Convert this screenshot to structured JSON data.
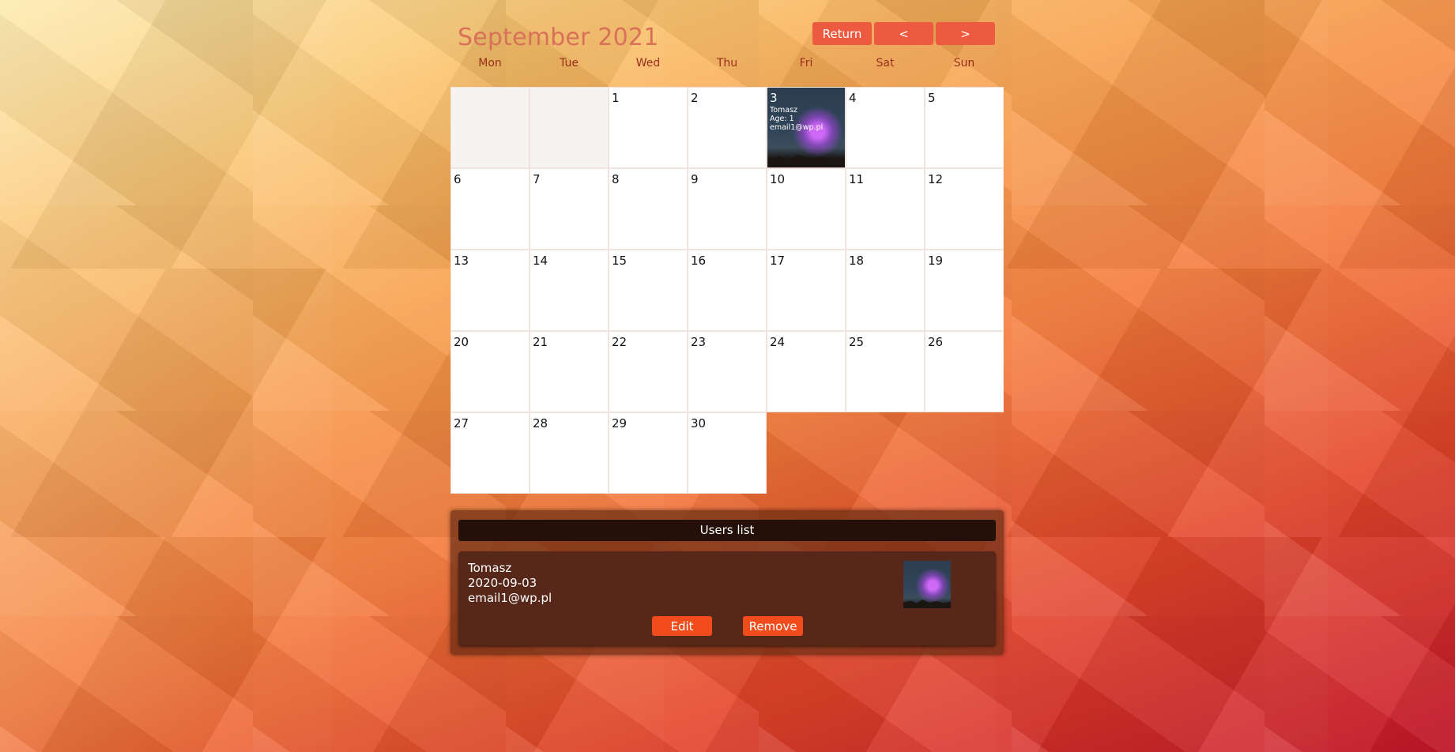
{
  "header": {
    "month_title": "September 2021",
    "return_label": "Return",
    "prev_label": "<",
    "next_label": ">"
  },
  "weekdays": [
    "Mon",
    "Tue",
    "Wed",
    "Thu",
    "Fri",
    "Sat",
    "Sun"
  ],
  "calendar": {
    "days": [
      "1",
      "2",
      "3",
      "4",
      "5",
      "6",
      "7",
      "8",
      "9",
      "10",
      "11",
      "12",
      "13",
      "14",
      "15",
      "16",
      "17",
      "18",
      "19",
      "20",
      "21",
      "22",
      "23",
      "24",
      "25",
      "26",
      "27",
      "28",
      "29",
      "30"
    ],
    "event": {
      "day": "3",
      "name": "Tomasz",
      "age": "Age: 1",
      "email": "email1@wp.pl"
    }
  },
  "users_list": {
    "title": "Users list",
    "users": [
      {
        "name": "Tomasz",
        "date": "2020-09-03",
        "email": "email1@wp.pl",
        "edit_label": "Edit",
        "remove_label": "Remove"
      }
    ]
  }
}
